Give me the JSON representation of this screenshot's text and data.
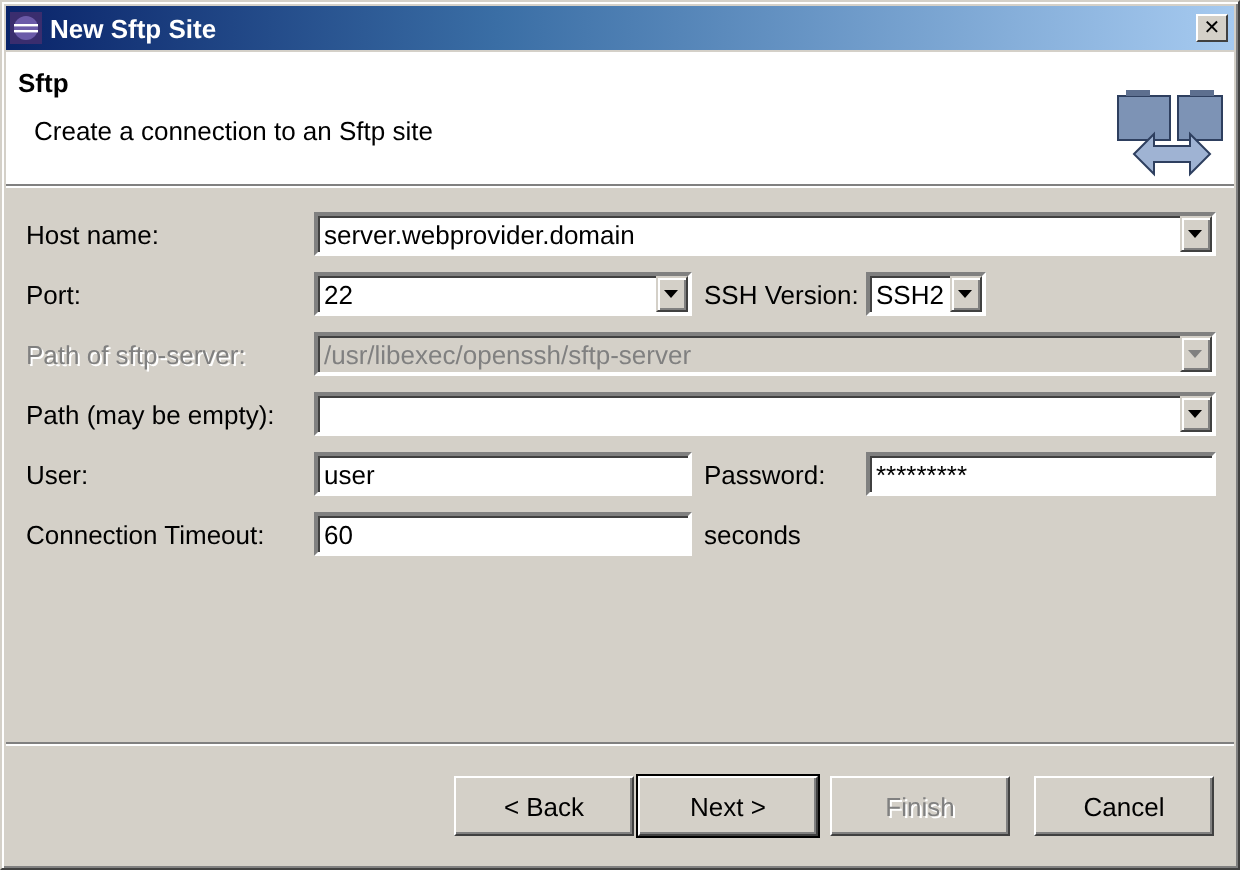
{
  "window": {
    "title": "New Sftp Site",
    "close": "✕"
  },
  "header": {
    "title": "Sftp",
    "description": "Create a connection to an Sftp site"
  },
  "rows": [
    {
      "items": [
        {
          "kind": "combo",
          "label": "Host name:",
          "value": "server.webprovider.domain",
          "disabled": false
        }
      ]
    },
    {
      "items": [
        {
          "kind": "combo",
          "label": "Port:",
          "value": "22",
          "disabled": false
        },
        {
          "kind": "combo",
          "label": "SSH Version:",
          "value": "SSH2",
          "disabled": false
        }
      ]
    },
    {
      "items": [
        {
          "kind": "combo",
          "label": "Path of sftp-server:",
          "value": "/usr/libexec/openssh/sftp-server",
          "disabled": true
        }
      ]
    },
    {
      "items": [
        {
          "kind": "combo",
          "label": "Path (may be empty):",
          "disabled": false
        }
      ]
    },
    {
      "items": [
        {
          "kind": "text",
          "label": "User:",
          "value": "user",
          "disabled": false
        },
        {
          "kind": "text",
          "label": "Password:",
          "value": "*********",
          "disabled": false
        }
      ]
    },
    {
      "items": [
        {
          "kind": "text",
          "label": "Connection Timeout:",
          "value": "60",
          "disabled": false
        },
        {
          "kind": "note",
          "label": "seconds"
        }
      ]
    }
  ],
  "buttons": [
    {
      "label": "< Back",
      "disabled": false,
      "default": false
    },
    {
      "label": "Next >",
      "disabled": false,
      "default": true
    },
    {
      "label": "Finish",
      "disabled": true,
      "default": false
    },
    {
      "label": "Cancel",
      "disabled": false,
      "default": false
    }
  ]
}
